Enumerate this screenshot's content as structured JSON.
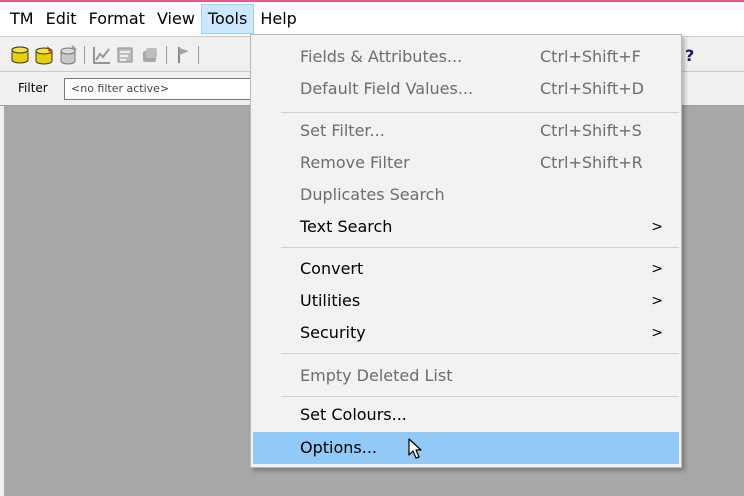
{
  "menubar": {
    "items": [
      "TM",
      "Edit",
      "Format",
      "View",
      "Tools",
      "Help"
    ],
    "active_item": "Tools"
  },
  "toolbar": {
    "icons": [
      "database-open-icon",
      "database-edit-icon",
      "database-delete-icon",
      "chart-icon",
      "form-icon",
      "records-icon",
      "flag-icon",
      "help-icon"
    ]
  },
  "filter": {
    "label": "Filter",
    "value": "<no filter active>"
  },
  "tools_menu": {
    "items": [
      {
        "label": "Fields & Attributes...",
        "shortcut": "Ctrl+Shift+F",
        "disabled": true
      },
      {
        "label": "Default Field Values...",
        "shortcut": "Ctrl+Shift+D",
        "disabled": true
      },
      {
        "label": "Set Filter...",
        "shortcut": "Ctrl+Shift+S",
        "disabled": true
      },
      {
        "label": "Remove Filter",
        "shortcut": "Ctrl+Shift+R",
        "disabled": true
      },
      {
        "label": "Duplicates Search",
        "shortcut": "",
        "disabled": true
      },
      {
        "label": "Text Search",
        "shortcut": "",
        "submenu": true
      },
      {
        "label": "Convert",
        "shortcut": "",
        "submenu": true
      },
      {
        "label": "Utilities",
        "shortcut": "",
        "submenu": true
      },
      {
        "label": "Security",
        "shortcut": "",
        "submenu": true
      },
      {
        "label": "Empty Deleted List",
        "shortcut": "",
        "disabled": true
      },
      {
        "label": "Set Colours...",
        "shortcut": ""
      },
      {
        "label": "Options...",
        "shortcut": "",
        "highlighted": true
      }
    ],
    "submenu_arrow": ">"
  },
  "colors": {
    "workspace": "#a8a8a8",
    "highlight": "#91c9f7",
    "menubar_active": "#cce8ff"
  }
}
